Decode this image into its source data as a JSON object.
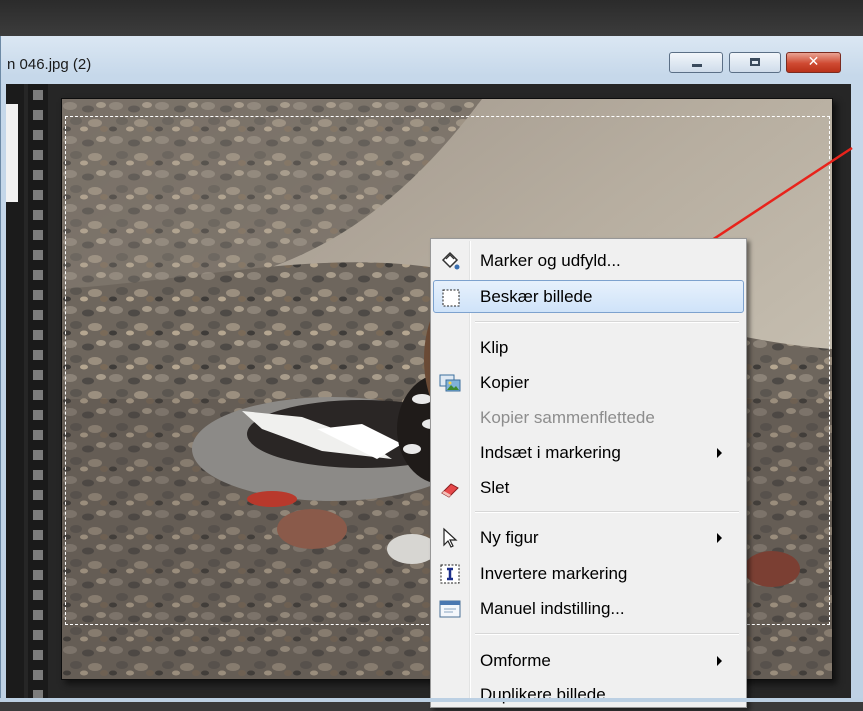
{
  "window": {
    "title": "n 046.jpg (2)",
    "buttons": {
      "minimize": "minimize",
      "maximize": "maximize",
      "close": "✕"
    }
  },
  "context_menu": {
    "items": [
      {
        "label": "Marker og udfyld...",
        "icon": "fill-select-icon",
        "enabled": true
      },
      {
        "label": "Beskær billede",
        "icon": "crop-icon",
        "enabled": true,
        "highlighted": true
      },
      {
        "label": "Klip",
        "icon": "",
        "enabled": true
      },
      {
        "label": "Kopier",
        "icon": "copy-image-icon",
        "enabled": true
      },
      {
        "label": "Kopier sammenflettede",
        "icon": "",
        "enabled": false
      },
      {
        "label": "Indsæt i markering",
        "icon": "",
        "enabled": true,
        "submenu": true
      },
      {
        "label": "Slet",
        "icon": "eraser-icon",
        "enabled": true
      },
      {
        "label": "Ny figur",
        "icon": "pointer-icon",
        "enabled": true,
        "submenu": true
      },
      {
        "label": "Invertere markering",
        "icon": "invert-selection-icon",
        "enabled": true
      },
      {
        "label": "Manuel indstilling...",
        "icon": "manual-settings-icon",
        "enabled": true
      },
      {
        "label": "Omforme",
        "icon": "",
        "enabled": true,
        "submenu": true
      },
      {
        "label": "Duplikere billede",
        "icon": "",
        "enabled": true
      }
    ]
  },
  "colors": {
    "annotation_arrow": "#e8231b",
    "menu_highlight": "#cfe3f9",
    "close_button": "#cf4a32"
  }
}
